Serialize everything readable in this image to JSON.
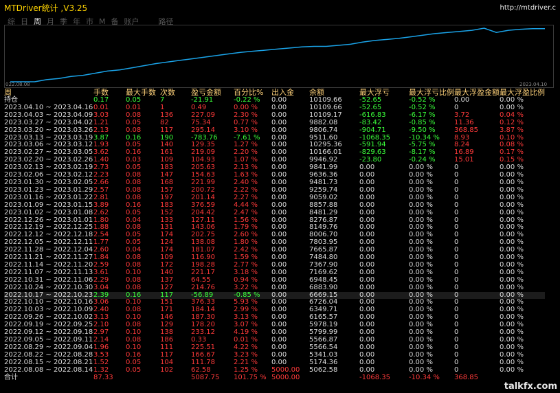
{
  "app": {
    "title": "MTDriver统计 ,V3.25",
    "url": "http://mtdriver.c"
  },
  "tabs": [
    "综",
    "日",
    "周",
    "月",
    "季",
    "年",
    "市",
    "M",
    "备",
    "账户",
    "路径"
  ],
  "active_tab": "周",
  "chart": {
    "start_label": "022.08.08",
    "end_label": "2023.04.10",
    "line_color": "#1aa3e8",
    "values": [
      0.0,
      0.0,
      0.0,
      0.04,
      0.06,
      0.1,
      0.12,
      0.16,
      0.2,
      0.22,
      0.26,
      0.3,
      0.34,
      0.37,
      0.4,
      0.43,
      0.46,
      0.49,
      0.52,
      0.55,
      0.57,
      0.59,
      0.61,
      0.63,
      0.65,
      0.66,
      0.66,
      0.68,
      0.7,
      0.74,
      0.77,
      0.79,
      0.81,
      0.84,
      0.87,
      0.9,
      0.92,
      0.94,
      0.96,
      1.0,
      0.92,
      0.96,
      0.98,
      0.99,
      0.99
    ]
  },
  "headers": [
    "周",
    "手数",
    "最大手数",
    "次数",
    "盈亏金额",
    "百分比%",
    "出入金",
    "余额",
    "最大浮亏",
    "最大浮亏比例",
    "最大浮盈金额",
    "最大浮盈比例"
  ],
  "rows": [
    {
      "c": [
        "持仓",
        "0.17",
        "0.05",
        "7",
        "-21.91",
        "-0.22 %",
        "0.00",
        "10109.66",
        "-52.65",
        "-0.52 %",
        "0.00",
        "0.00 %"
      ],
      "k": [
        "w",
        "g",
        "g",
        "g",
        "g",
        "g",
        "w",
        "w",
        "g",
        "g",
        "w",
        "w"
      ]
    },
    {
      "c": [
        "2023.04.10 ~ 2023.04.16",
        "0.01",
        "0.01",
        "1",
        "0.49",
        "0.00 %",
        "0.00",
        "10109.66",
        "-52.65",
        "-0.52 %",
        "0",
        "0.00 %"
      ],
      "k": [
        "w",
        "r",
        "r",
        "r",
        "r",
        "r",
        "w",
        "w",
        "g",
        "g",
        "w",
        "w"
      ]
    },
    {
      "c": [
        "2023.04.03 ~ 2023.04.09",
        "3.03",
        "0.08",
        "136",
        "227.09",
        "2.30 %",
        "0.00",
        "10109.17",
        "-616.83",
        "-6.17 %",
        "3.72",
        "0.04 %"
      ],
      "k": [
        "w",
        "r",
        "r",
        "r",
        "r",
        "r",
        "w",
        "w",
        "g",
        "g",
        "r",
        "r"
      ]
    },
    {
      "c": [
        "2023.03.27 ~ 2023.04.02",
        "1.21",
        "0.05",
        "82",
        "75.34",
        "0.77 %",
        "0.00",
        "9882.08",
        "-83.42",
        "-0.85 %",
        "11.36",
        "0.12 %"
      ],
      "k": [
        "w",
        "r",
        "r",
        "r",
        "r",
        "r",
        "w",
        "w",
        "g",
        "g",
        "r",
        "r"
      ]
    },
    {
      "c": [
        "2023.03.20 ~ 2023.03.26",
        "2.13",
        "0.08",
        "117",
        "295.14",
        "3.10 %",
        "0.00",
        "9806.74",
        "-904.71",
        "-9.50 %",
        "368.85",
        "3.87 %"
      ],
      "k": [
        "w",
        "r",
        "r",
        "r",
        "r",
        "r",
        "w",
        "w",
        "g",
        "g",
        "r",
        "r"
      ]
    },
    {
      "c": [
        "2023.03.13 ~ 2023.03.19",
        "3.87",
        "0.16",
        "190",
        "-783.76",
        "-7.61 %",
        "0.00",
        "9511.60",
        "-1068.35",
        "-10.34 %",
        "8.93",
        "0.10 %"
      ],
      "k": [
        "w",
        "g",
        "g",
        "g",
        "g",
        "g",
        "w",
        "w",
        "g",
        "g",
        "r",
        "r"
      ]
    },
    {
      "c": [
        "2023.03.06 ~ 2023.03.12",
        "1.93",
        "0.05",
        "140",
        "129.35",
        "1.27 %",
        "0.00",
        "10295.36",
        "-591.94",
        "-5.75 %",
        "8.24",
        "0.08 %"
      ],
      "k": [
        "w",
        "r",
        "r",
        "r",
        "r",
        "r",
        "w",
        "w",
        "g",
        "g",
        "r",
        "r"
      ]
    },
    {
      "c": [
        "2023.02.27 ~ 2023.03.05",
        "3.62",
        "0.16",
        "161",
        "219.09",
        "2.20 %",
        "0.00",
        "10166.01",
        "-829.63",
        "-8.17 %",
        "16.89",
        "0.17 %"
      ],
      "k": [
        "w",
        "r",
        "r",
        "r",
        "r",
        "r",
        "w",
        "w",
        "g",
        "g",
        "r",
        "r"
      ]
    },
    {
      "c": [
        "2023.02.20 ~ 2023.02.26",
        "1.40",
        "0.03",
        "109",
        "104.93",
        "1.07 %",
        "0.00",
        "9946.92",
        "-23.80",
        "-0.24 %",
        "15.01",
        "0.15 %"
      ],
      "k": [
        "w",
        "r",
        "r",
        "r",
        "r",
        "r",
        "w",
        "w",
        "g",
        "g",
        "r",
        "r"
      ]
    },
    {
      "c": [
        "2023.02.13 ~ 2023.02.19",
        "2.73",
        "0.05",
        "183",
        "205.63",
        "2.13 %",
        "0.00",
        "9841.99",
        "0.00",
        "0.00 %",
        "0",
        "0.00 %"
      ],
      "k": [
        "w",
        "r",
        "r",
        "r",
        "r",
        "r",
        "w",
        "w",
        "w",
        "w",
        "w",
        "w"
      ]
    },
    {
      "c": [
        "2023.02.06 ~ 2023.02.12",
        "2.23",
        "0.08",
        "147",
        "154.63",
        "1.63 %",
        "0.00",
        "9636.36",
        "0.00",
        "0.00 %",
        "0",
        "0.00 %"
      ],
      "k": [
        "w",
        "r",
        "r",
        "r",
        "r",
        "r",
        "w",
        "w",
        "w",
        "w",
        "w",
        "w"
      ]
    },
    {
      "c": [
        "2023.01.30 ~ 2023.02.05",
        "2.66",
        "0.08",
        "168",
        "221.99",
        "2.40 %",
        "0.00",
        "9481.73",
        "0.00",
        "0.00 %",
        "0",
        "0.00 %"
      ],
      "k": [
        "w",
        "r",
        "r",
        "r",
        "r",
        "r",
        "w",
        "w",
        "w",
        "w",
        "w",
        "w"
      ]
    },
    {
      "c": [
        "2023.01.23 ~ 2023.01.29",
        "2.57",
        "0.08",
        "157",
        "200.72",
        "2.22 %",
        "0.00",
        "9259.74",
        "0.00",
        "0.00 %",
        "0",
        "0.00 %"
      ],
      "k": [
        "w",
        "r",
        "r",
        "r",
        "r",
        "r",
        "w",
        "w",
        "w",
        "w",
        "w",
        "w"
      ]
    },
    {
      "c": [
        "2023.01.16 ~ 2023.01.22",
        "2.81",
        "0.08",
        "197",
        "201.14",
        "2.27 %",
        "0.00",
        "9059.02",
        "0.00",
        "0.00 %",
        "0",
        "0.00 %"
      ],
      "k": [
        "w",
        "r",
        "r",
        "r",
        "r",
        "r",
        "w",
        "w",
        "w",
        "w",
        "w",
        "w"
      ]
    },
    {
      "c": [
        "2023.01.09 ~ 2023.01.15",
        "3.89",
        "0.16",
        "183",
        "376.59",
        "4.44 %",
        "0.00",
        "8857.88",
        "0.00",
        "0.00 %",
        "0",
        "0.00 %"
      ],
      "k": [
        "w",
        "r",
        "r",
        "r",
        "r",
        "r",
        "w",
        "w",
        "w",
        "w",
        "w",
        "w"
      ]
    },
    {
      "c": [
        "2023.01.02 ~ 2023.01.08",
        "2.62",
        "0.05",
        "152",
        "204.42",
        "2.47 %",
        "0.00",
        "8481.29",
        "0.00",
        "0.00 %",
        "0",
        "0.00 %"
      ],
      "k": [
        "w",
        "r",
        "r",
        "r",
        "r",
        "r",
        "w",
        "w",
        "w",
        "w",
        "w",
        "w"
      ]
    },
    {
      "c": [
        "2022.12.26 ~ 2023.01.01",
        "1.80",
        "0.04",
        "133",
        "127.11",
        "1.56 %",
        "0.00",
        "8276.87",
        "0.00",
        "0.00 %",
        "0",
        "0.00 %"
      ],
      "k": [
        "w",
        "r",
        "r",
        "r",
        "r",
        "r",
        "w",
        "w",
        "w",
        "w",
        "w",
        "w"
      ]
    },
    {
      "c": [
        "2022.12.19 ~ 2022.12.25",
        "1.88",
        "0.08",
        "131",
        "143.06",
        "1.79 %",
        "0.00",
        "8149.76",
        "0.00",
        "0.00 %",
        "0",
        "0.00 %"
      ],
      "k": [
        "w",
        "r",
        "r",
        "r",
        "r",
        "r",
        "w",
        "w",
        "w",
        "w",
        "w",
        "w"
      ]
    },
    {
      "c": [
        "2022.12.12 ~ 2022.12.18",
        "2.54",
        "0.05",
        "174",
        "202.75",
        "2.60 %",
        "0.00",
        "8006.70",
        "0.00",
        "0.00 %",
        "0",
        "0.00 %"
      ],
      "k": [
        "w",
        "r",
        "r",
        "r",
        "r",
        "r",
        "w",
        "w",
        "w",
        "w",
        "w",
        "w"
      ]
    },
    {
      "c": [
        "2022.12.05 ~ 2022.12.11",
        "1.77",
        "0.05",
        "124",
        "138.08",
        "1.80 %",
        "0.00",
        "7803.95",
        "0.00",
        "0.00 %",
        "0",
        "0.00 %"
      ],
      "k": [
        "w",
        "r",
        "r",
        "r",
        "r",
        "r",
        "w",
        "w",
        "w",
        "w",
        "w",
        "w"
      ]
    },
    {
      "c": [
        "2022.11.28 ~ 2022.12.04",
        "2.60",
        "0.04",
        "174",
        "181.07",
        "2.42 %",
        "0.00",
        "7665.87",
        "0.00",
        "0.00 %",
        "0",
        "0.00 %"
      ],
      "k": [
        "w",
        "r",
        "r",
        "r",
        "r",
        "r",
        "w",
        "w",
        "w",
        "w",
        "w",
        "w"
      ]
    },
    {
      "c": [
        "2022.11.21 ~ 2022.11.27",
        "1.84",
        "0.08",
        "109",
        "116.90",
        "1.59 %",
        "0.00",
        "7484.80",
        "0.00",
        "0.00 %",
        "0",
        "0.00 %"
      ],
      "k": [
        "w",
        "r",
        "r",
        "r",
        "r",
        "r",
        "w",
        "w",
        "w",
        "w",
        "w",
        "w"
      ]
    },
    {
      "c": [
        "2022.11.14 ~ 2022.11.20",
        "2.59",
        "0.08",
        "172",
        "198.28",
        "2.77 %",
        "0.00",
        "7367.90",
        "0.00",
        "0.00 %",
        "0",
        "0.00 %"
      ],
      "k": [
        "w",
        "r",
        "r",
        "r",
        "r",
        "r",
        "w",
        "w",
        "w",
        "w",
        "w",
        "w"
      ]
    },
    {
      "c": [
        "2022.11.07 ~ 2022.11.13",
        "3.61",
        "0.10",
        "140",
        "221.17",
        "3.18 %",
        "0.00",
        "7169.62",
        "0.00",
        "0.00 %",
        "0",
        "0.00 %"
      ],
      "k": [
        "w",
        "r",
        "r",
        "r",
        "r",
        "r",
        "w",
        "w",
        "w",
        "w",
        "w",
        "w"
      ]
    },
    {
      "c": [
        "2022.10.31 ~ 2022.11.06",
        "2.29",
        "0.08",
        "137",
        "64.55",
        "0.94 %",
        "0.00",
        "6948.45",
        "0.00",
        "0.00 %",
        "0",
        "0.00 %"
      ],
      "k": [
        "w",
        "r",
        "r",
        "r",
        "r",
        "r",
        "w",
        "w",
        "w",
        "w",
        "w",
        "w"
      ]
    },
    {
      "c": [
        "2022.10.24 ~ 2022.10.30",
        "3.04",
        "0.08",
        "127",
        "214.76",
        "3.22 %",
        "0.00",
        "6883.90",
        "0.00",
        "0.00 %",
        "0",
        "0.00 %"
      ],
      "k": [
        "w",
        "r",
        "r",
        "r",
        "r",
        "r",
        "w",
        "w",
        "w",
        "w",
        "w",
        "w"
      ]
    },
    {
      "c": [
        "2022.10.17 ~ 2022.10.23",
        "2.39",
        "0.16",
        "117",
        "-56.89",
        "-0.85 %",
        "0.00",
        "6669.15",
        "0.00",
        "0.00 %",
        "0",
        "0.00 %"
      ],
      "k": [
        "w",
        "g",
        "g",
        "g",
        "g",
        "g",
        "w",
        "w",
        "w",
        "w",
        "w",
        "w"
      ]
    },
    {
      "c": [
        "2022.10.10 ~ 2022.10.16",
        "3.06",
        "0.10",
        "151",
        "376.33",
        "5.93 %",
        "0.00",
        "6726.04",
        "0.00",
        "0.00 %",
        "0",
        "0.00 %"
      ],
      "k": [
        "w",
        "r",
        "r",
        "r",
        "r",
        "r",
        "w",
        "w",
        "w",
        "w",
        "w",
        "w"
      ]
    },
    {
      "c": [
        "2022.10.03 ~ 2022.10.09",
        "2.40",
        "0.08",
        "171",
        "184.14",
        "2.99 %",
        "0.00",
        "6349.71",
        "0.00",
        "0.00 %",
        "0",
        "0.00 %"
      ],
      "k": [
        "w",
        "r",
        "r",
        "r",
        "r",
        "r",
        "w",
        "w",
        "w",
        "w",
        "w",
        "w"
      ]
    },
    {
      "c": [
        "2022.09.26 ~ 2022.10.02",
        "3.13",
        "0.10",
        "146",
        "187.30",
        "3.13 %",
        "0.00",
        "6165.57",
        "0.00",
        "0.00 %",
        "0",
        "0.00 %"
      ],
      "k": [
        "w",
        "r",
        "r",
        "r",
        "r",
        "r",
        "w",
        "w",
        "w",
        "w",
        "w",
        "w"
      ]
    },
    {
      "c": [
        "2022.09.19 ~ 2022.09.25",
        "2.10",
        "0.08",
        "129",
        "178.20",
        "3.07 %",
        "0.00",
        "5978.19",
        "0.00",
        "0.00 %",
        "0",
        "0.00 %"
      ],
      "k": [
        "w",
        "r",
        "r",
        "r",
        "r",
        "r",
        "w",
        "w",
        "w",
        "w",
        "w",
        "w"
      ]
    },
    {
      "c": [
        "2022.09.12 ~ 2022.09.18",
        "2.97",
        "0.10",
        "138",
        "233.12",
        "4.19 %",
        "0.00",
        "5799.99",
        "0.00",
        "0.00 %",
        "0",
        "0.00 %"
      ],
      "k": [
        "w",
        "r",
        "r",
        "r",
        "r",
        "r",
        "w",
        "w",
        "w",
        "w",
        "w",
        "w"
      ]
    },
    {
      "c": [
        "2022.09.05 ~ 2022.09.11",
        "2.14",
        "0.08",
        "186",
        "0.33",
        "0.01 %",
        "0.00",
        "5566.87",
        "0.00",
        "0.00 %",
        "0",
        "0.00 %"
      ],
      "k": [
        "w",
        "r",
        "r",
        "r",
        "r",
        "r",
        "w",
        "w",
        "w",
        "w",
        "w",
        "w"
      ]
    },
    {
      "c": [
        "2022.08.29 ~ 2022.09.04",
        "1.96",
        "0.10",
        "111",
        "225.51",
        "4.22 %",
        "0.00",
        "5566.54",
        "0.00",
        "0.00 %",
        "0",
        "0.00 %"
      ],
      "k": [
        "w",
        "r",
        "r",
        "r",
        "r",
        "r",
        "w",
        "w",
        "w",
        "w",
        "w",
        "w"
      ]
    },
    {
      "c": [
        "2022.08.22 ~ 2022.08.28",
        "3.53",
        "0.16",
        "117",
        "166.67",
        "3.23 %",
        "0.00",
        "5341.03",
        "0.00",
        "0.00 %",
        "0",
        "0.00 %"
      ],
      "k": [
        "w",
        "r",
        "r",
        "r",
        "r",
        "r",
        "w",
        "w",
        "w",
        "w",
        "w",
        "w"
      ]
    },
    {
      "c": [
        "2022.08.15 ~ 2022.08.21",
        "1.52",
        "0.05",
        "104",
        "111.78",
        "2.21 %",
        "0.00",
        "5174.36",
        "0.00",
        "0.00 %",
        "0",
        "0.00 %"
      ],
      "k": [
        "w",
        "r",
        "r",
        "r",
        "r",
        "r",
        "w",
        "w",
        "w",
        "w",
        "w",
        "w"
      ]
    },
    {
      "c": [
        "2022.08.08 ~ 2022.08.14",
        "1.32",
        "0.05",
        "102",
        "62.58",
        "1.25 %",
        "5000.00",
        "5062.58",
        "0.00",
        "0.00 %",
        "0",
        "0.00 %"
      ],
      "k": [
        "w",
        "r",
        "r",
        "r",
        "r",
        "r",
        "r",
        "w",
        "w",
        "w",
        "w",
        "w"
      ]
    }
  ],
  "total": {
    "c": [
      "合计",
      "87.33",
      "",
      "",
      "5087.75",
      "101.75 %",
      "5000.00",
      "",
      "-1068.35",
      "-10.34 %",
      "368.85",
      ""
    ],
    "k": [
      "w",
      "r",
      "r",
      "r",
      "r",
      "r",
      "r",
      "w",
      "g",
      "g",
      "r",
      "r"
    ]
  },
  "watermark": "talkfx.com"
}
